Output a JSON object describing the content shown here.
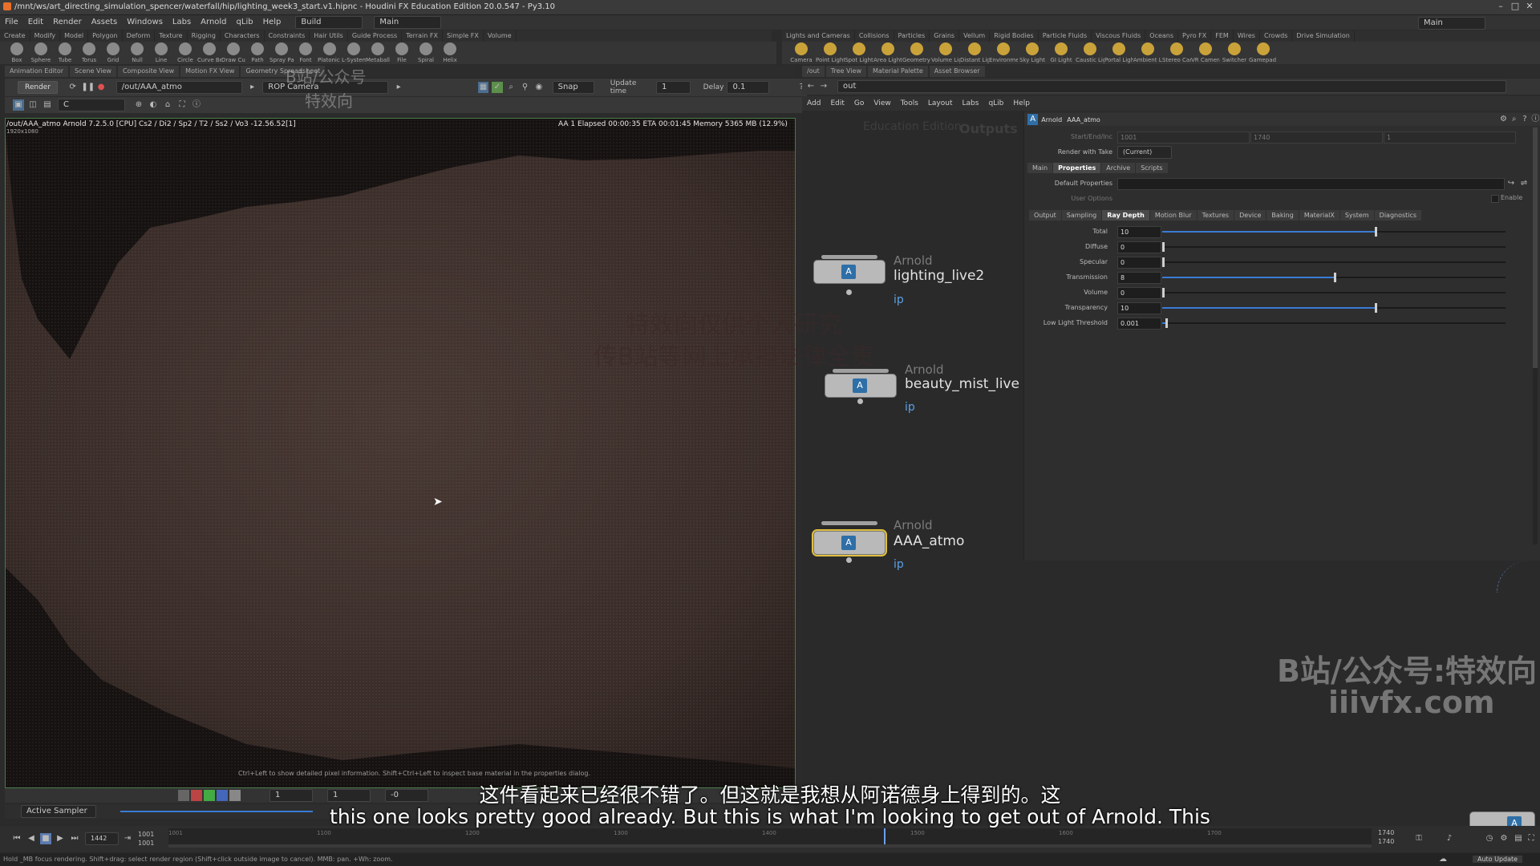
{
  "window": {
    "title": "/mnt/ws/art_directing_simulation_spencer/waterfall/hip/lighting_week3_start.v1.hipnc - Houdini FX Education Edition 20.0.547 - Py3.10"
  },
  "menu": [
    "File",
    "Edit",
    "Render",
    "Assets",
    "Windows",
    "Labs",
    "Arnold",
    "qLib",
    "Help"
  ],
  "build_dropdown": "Build",
  "main_dropdown": "Main",
  "right_desktop": "Main",
  "shelf_tabs_left": [
    "Create",
    "Modify",
    "Model",
    "Polygon",
    "Deform",
    "Texture",
    "Rigging",
    "Characters",
    "Constraints",
    "Hair Utils",
    "Guide Process",
    "Terrain FX",
    "Simple FX",
    "Volume"
  ],
  "shelf_tools_left": [
    "Box",
    "Sphere",
    "Tube",
    "Torus",
    "Grid",
    "Null",
    "Line",
    "Circle",
    "Curve Bezier",
    "Draw Curve",
    "Path",
    "Spray Paint",
    "Font",
    "Platonic Solids",
    "L-System",
    "Metaball",
    "File",
    "Spiral",
    "Helix"
  ],
  "shelf_tabs_right": [
    "Lights and Cameras",
    "Collisions",
    "Particles",
    "Grains",
    "Vellum",
    "Rigid Bodies",
    "Particle Fluids",
    "Viscous Fluids",
    "Oceans",
    "Pyro FX",
    "FEM",
    "Wires",
    "Crowds",
    "Drive Simulation"
  ],
  "shelf_tools_right": [
    "Camera",
    "Point Light",
    "Spot Light",
    "Area Light",
    "Geometry Light",
    "Volume Light",
    "Distant Light",
    "Environment Light",
    "Sky Light",
    "GI Light",
    "Caustic Light",
    "Portal Light",
    "Ambient Light",
    "Stereo Camera",
    "VR Camera",
    "Switcher",
    "Gamepad Camera"
  ],
  "left_pane_tabs": [
    "Animation Editor",
    "Scene View",
    "Composite View",
    "Motion FX View",
    "Geometry Spreadsheet"
  ],
  "render_view": {
    "render_button": "Render",
    "rop_path": "/out/AAA_atmo",
    "camera": "ROP Camera",
    "snap": "Snap",
    "update_time_label": "Update time",
    "update_time_value": "1",
    "delay_label": "Delay",
    "delay_value": "0.1",
    "channel": "C",
    "header_left": "/out/AAA_atmo  Arnold 7.2.5.0 [CPU]  Cs2 / Di2 / Sp2 / T2 / Ss2 / Vo3 -12.56.52[1]",
    "header_res": "1920x1080",
    "header_right": "AA 1  Elapsed 00:00:35  ETA 00:01:45  Memory 5365 MB  (12.9%)",
    "hint": "Ctrl+Left to show detailed pixel information. Shift+Ctrl+Left to inspect base material in the properties dialog.",
    "frame_field": "1",
    "gamma_field": "1",
    "exposure_field": "-0",
    "active_sampler": "Active Sampler"
  },
  "right_pane_tabs": [
    "/out",
    "Tree View",
    "Material Palette",
    "Asset Browser"
  ],
  "network": {
    "path": "out",
    "menu": [
      "Add",
      "Edit",
      "Go",
      "View",
      "Tools",
      "Layout",
      "Labs",
      "qLib",
      "Help"
    ],
    "edition": "Education Edition",
    "context": "Outputs",
    "nodes": [
      {
        "type": "Arnold",
        "name": "lighting_live2",
        "flag": "ip",
        "selected": false
      },
      {
        "type": "Arnold",
        "name": "beauty_mist_live",
        "flag": "ip",
        "selected": false
      },
      {
        "type": "Arnold",
        "name": "AAA_atmo",
        "flag": "ip",
        "selected": true
      }
    ]
  },
  "params": {
    "header_type": "Arnold",
    "header_name": "AAA_atmo",
    "start_end_label": "Start/End/Inc",
    "start_end_values": [
      "1001",
      "1740",
      "1"
    ],
    "render_with_take_label": "Render with Take",
    "render_with_take_value": "(Current)",
    "top_tabs": [
      "Main",
      "Properties",
      "Archive",
      "Scripts"
    ],
    "default_properties_label": "Default Properties",
    "user_options_label": "User Options",
    "enable_label": "Enable",
    "sub_tabs": [
      "Output",
      "Sampling",
      "Ray Depth",
      "Motion Blur",
      "Textures",
      "Device",
      "Baking",
      "MaterialX",
      "System",
      "Diagnostics"
    ],
    "active_sub_tab": "Ray Depth",
    "rows": [
      {
        "label": "Total",
        "value": "10",
        "fraction": 0.62
      },
      {
        "label": "Diffuse",
        "value": "0",
        "fraction": 0.0
      },
      {
        "label": "Specular",
        "value": "0",
        "fraction": 0.0
      },
      {
        "label": "Transmission",
        "value": "8",
        "fraction": 0.5
      },
      {
        "label": "Volume",
        "value": "0",
        "fraction": 0.0
      },
      {
        "label": "Transparency",
        "value": "10",
        "fraction": 0.62
      },
      {
        "label": "Low Light Threshold",
        "value": "0.001",
        "fraction": 0.01
      }
    ]
  },
  "timeline": {
    "current_frame": "1442",
    "start_a": "1001",
    "start_b": "1001",
    "end_a": "1740",
    "end_b": "1740",
    "ticks": [
      "1001",
      "1100",
      "1200",
      "1300",
      "1400",
      "1500",
      "1600",
      "1700"
    ],
    "auto_update": "Auto Update"
  },
  "status_text": "Hold _MB focus rendering. Shift+drag: select render region (Shift+click outside image to cancel). MMB: pan. +Wh: zoom.",
  "subtitles": {
    "zh": "这件看起来已经很不错了。但这就是我想从阿诺德身上得到的。这",
    "en": "this one looks pretty good already. But this is what I'm looking to get out of Arnold. This"
  },
  "watermarks": {
    "top_left_1": "B站/公众号",
    "top_left_2": "特效向",
    "center_1": "特效向仅供个人研究",
    "center_2": "传B站等网上承担法律全责",
    "right_1": "B站/公众号:特效向",
    "right_2": "iiivfx.com"
  },
  "colors": {
    "accent_blue": "#3a7bd5",
    "node_badge": "#2f6fa7",
    "selected_outline": "#e0c040",
    "ip_flag": "#5aa0e6"
  }
}
